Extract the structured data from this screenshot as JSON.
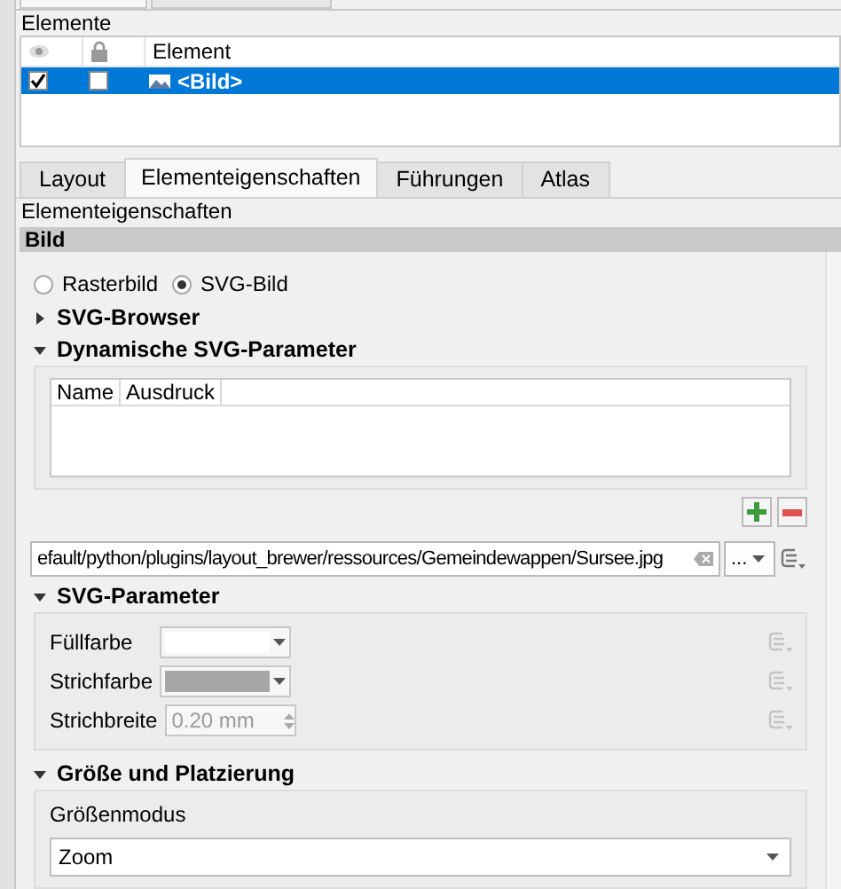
{
  "elements_panel": {
    "title": "Elemente",
    "column_label": "Element",
    "rows": [
      {
        "visible": true,
        "locked": false,
        "name": "<Bild>",
        "selected": true
      }
    ]
  },
  "tabs": [
    {
      "label": "Layout",
      "selected": false
    },
    {
      "label": "Elementeigenschaften",
      "selected": true
    },
    {
      "label": "Führungen",
      "selected": false
    },
    {
      "label": "Atlas",
      "selected": false
    }
  ],
  "properties_title": "Elementeigenschaften",
  "section_title": "Bild",
  "image_type": [
    {
      "label": "Rasterbild",
      "selected": false
    },
    {
      "label": "SVG-Bild",
      "selected": true
    }
  ],
  "svg_browser": {
    "title": "SVG-Browser",
    "expanded": false
  },
  "dynamic_parameters": {
    "title": "Dynamische SVG-Parameter",
    "expanded": true,
    "columns": [
      "Name",
      "Ausdruck"
    ]
  },
  "path_field": {
    "value": "efault/python/plugins/layout_brewer/ressources/Gemeindewappen/Sursee.jpg"
  },
  "browse_button": "...",
  "svg_parameters": {
    "title": "SVG-Parameter",
    "expanded": true,
    "rows": [
      {
        "kind": "color",
        "label": "Füllfarbe",
        "color": "#ffffff"
      },
      {
        "kind": "color",
        "label": "Strichfarbe",
        "color": "#a6a6a6"
      },
      {
        "kind": "number",
        "label": "Strichbreite",
        "value": "0.20 mm"
      }
    ]
  },
  "size_placement": {
    "title": "Größe und Platzierung",
    "expanded": true,
    "mode_label": "Größenmodus",
    "mode_value": "Zoom"
  }
}
